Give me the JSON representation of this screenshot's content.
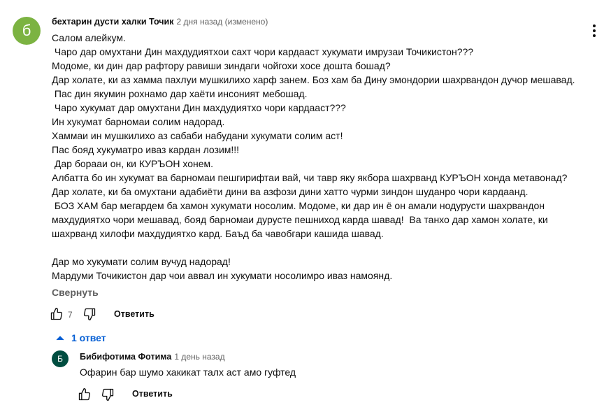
{
  "comment": {
    "avatar_letter": "б",
    "avatar_color": "#7cb342",
    "author": "бехтарин дусти халки Точик",
    "timestamp": "2 дня назад (изменено)",
    "lines": [
      "Салом алейкум.",
      " Чаро дар омухтани Дин махдудиятхои сахт чори кардааст хукумати имрузаи Точикистон???",
      "Модоме, ки дин дар рафтору равиши зиндаги чойгохи хосе дошта бошад?",
      "Дар холате, ки аз хамма пахлуи мушкилихо харф занем. Боз хам ба Дину эмондории шахрвандон дучор мешавад.",
      " Пас дин якумин рохнамо дар хаёти инсоният мебошад.",
      " Чаро хукумат дар омухтани Дин махдудиятхо чори кардааст???",
      "Ин хукумат барномаи солим надорад.",
      "Хаммаи ин мушкилихо аз сабаби набудани хукумати солим аст!",
      "Пас бояд хукуматро иваз кардан лозим!!!",
      " Дар борааи он, ки КУРЪОН хонем.",
      "Албатта бо ин хукумат ва барномаи пешгирифтаи вай, чи тавр яку якбора шахрванд КУРЪОН хонда метавонад?",
      "Дар холате, ки ба омухтани адабиёти дини ва азфози дини хатто чурми зиндон шуданро чори кардаанд.",
      " БОЗ ХАМ бар мегардем ба хамон хукумати носолим. Модоме, ки дар ин ё он амали нодурусти шахрвандон",
      "махдудиятхо чори мешавад, бояд барномаи дурусте пешниход карда шавад!  Ва танхо дар хамон холате, ки",
      "шахрванд хилофи махдудиятхо кард. Баъд ба чавобгари кашида шавад.",
      "",
      "Дар мо хукумати солим вучуд надорад!",
      "Мардуми Точикистон дар чои аввал ин хукумати носолимро иваз намоянд."
    ],
    "collapse_label": "Свернуть",
    "like_count": "7",
    "reply_label": "Ответить",
    "like_icon": "thumb-up-icon",
    "dislike_icon": "thumb-down-icon",
    "menu_icon": "more-vert-icon"
  },
  "replies_toggle": {
    "label": "1 ответ",
    "icon": "chevron-up-icon",
    "color": "#065fd4"
  },
  "reply": {
    "avatar_letter": "Б",
    "avatar_color": "#004d40",
    "author": "Бибифотима Фотима",
    "timestamp": "1 день назад",
    "text": "Офарин бар шумо хакикат талх аст амо гуфтед",
    "reply_label": "Ответить",
    "like_icon": "thumb-up-icon",
    "dislike_icon": "thumb-down-icon"
  }
}
